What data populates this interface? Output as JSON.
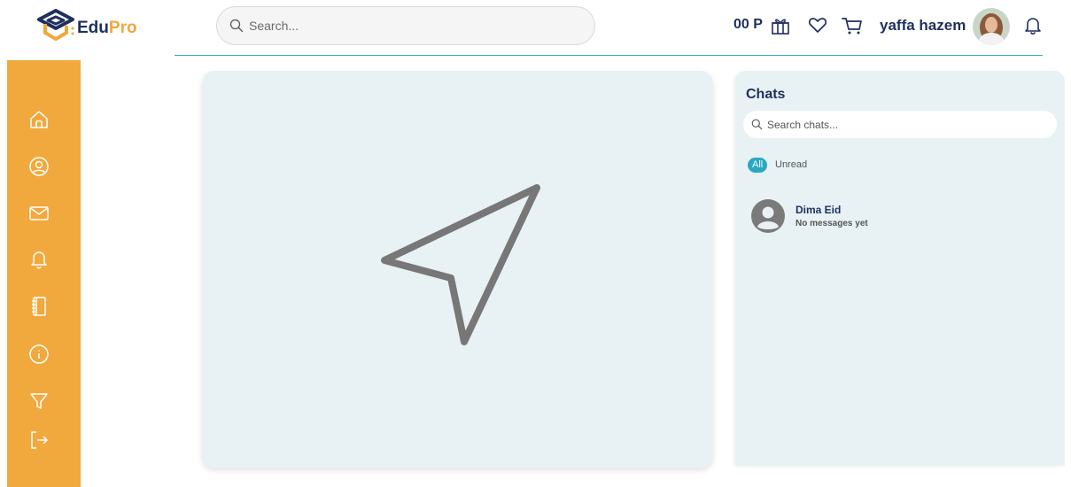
{
  "brand": {
    "name_part1": "Edu",
    "name_part2": "Pro",
    "primary_color": "#1f2f5f",
    "accent_color": "#f0a83c"
  },
  "header": {
    "search_placeholder": "Search...",
    "points": "00 P",
    "username": "yaffa hazem",
    "icons": [
      "gift-icon",
      "heart-icon",
      "cart-icon",
      "bell-icon"
    ]
  },
  "sidebar": {
    "background": "#f1a83c",
    "items": [
      "home-icon",
      "profile-icon",
      "mail-icon",
      "bell-icon",
      "notebook-icon",
      "info-icon",
      "filter-icon",
      "logout-icon"
    ]
  },
  "main": {
    "empty_state_icon": "send-icon"
  },
  "chats": {
    "title": "Chats",
    "search_placeholder": "Search chats...",
    "filters": {
      "all": "All",
      "unread": "Unread"
    },
    "items": [
      {
        "name": "Dima Eid",
        "preview": "No messages yet"
      }
    ]
  }
}
